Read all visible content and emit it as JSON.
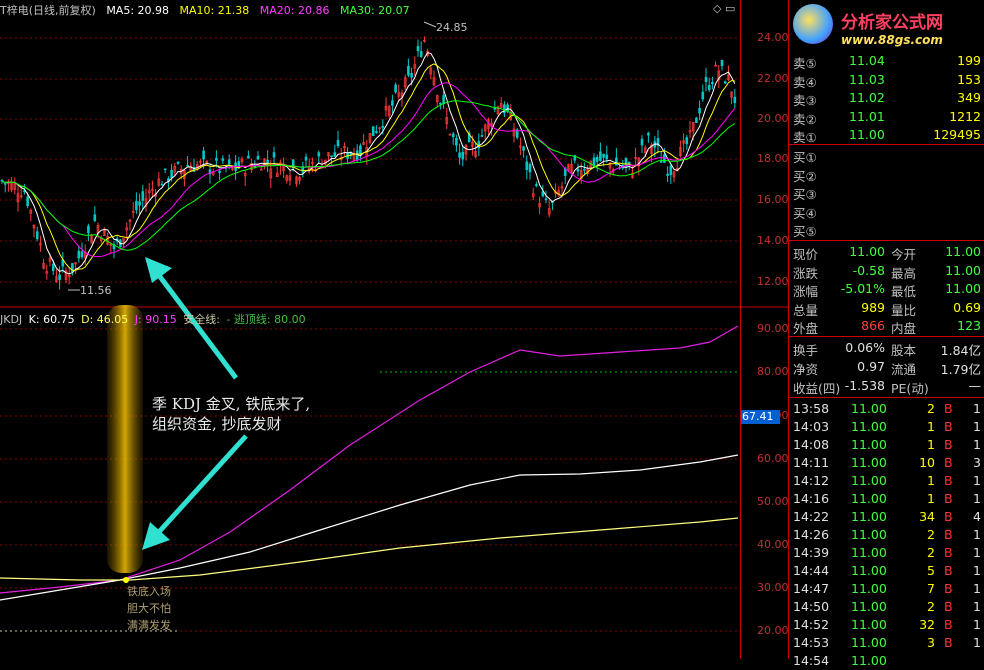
{
  "main_header": {
    "title": "T梓电(日线,前复权)",
    "ma5": "MA5: 20.98",
    "ma10": "MA10: 21.38",
    "ma20": "MA20: 20.86",
    "ma30": "MA30: 20.07"
  },
  "main_axis": [
    "24.00",
    "22.00",
    "20.00",
    "18.00",
    "16.00",
    "14.00",
    "12.00"
  ],
  "high_label": "24.85",
  "low_label": "11.56",
  "kdj_header": {
    "title": "JKDJ",
    "k": "K: 60.75",
    "d": "D: 46.05",
    "j": "J: 90.15",
    "safe": "安全线:",
    "escape": "- 逃顶线: 80.00"
  },
  "kdj_axis": [
    "90.00",
    "80.00",
    "70.00",
    "60.00",
    "50.00",
    "40.00",
    "30.00",
    "20.00"
  ],
  "kdj_marker": "67.41",
  "annotation": {
    "line1": "季 KDJ 金叉, 铁底来了,",
    "line2": "组织资金, 抄底发财"
  },
  "signal_text": {
    "line1": "铁底入场",
    "line2": "胆大不怕",
    "line3": "满满发发"
  },
  "logo": {
    "name": "分析家公式网",
    "url": "www.88gs.com"
  },
  "sell_orders": [
    {
      "label": "卖⑤",
      "price": "11.04",
      "vol": "199"
    },
    {
      "label": "卖④",
      "price": "11.03",
      "vol": "153"
    },
    {
      "label": "卖③",
      "price": "11.02",
      "vol": "349"
    },
    {
      "label": "卖②",
      "price": "11.01",
      "vol": "1212"
    },
    {
      "label": "卖①",
      "price": "11.00",
      "vol": "129495"
    }
  ],
  "buy_orders": [
    {
      "label": "买①"
    },
    {
      "label": "买②"
    },
    {
      "label": "买③"
    },
    {
      "label": "买④"
    },
    {
      "label": "买⑤"
    }
  ],
  "quote": [
    {
      "l1": "现价",
      "v1": "11.00",
      "l2": "今开",
      "v2": "11.00"
    },
    {
      "l1": "涨跌",
      "v1": "-0.58",
      "l2": "最高",
      "v2": "11.00"
    },
    {
      "l1": "涨幅",
      "v1": "-5.01%",
      "l2": "最低",
      "v2": "11.00"
    },
    {
      "l1": "总量",
      "v1": "989",
      "l2": "量比",
      "v2": "0.69"
    },
    {
      "l1": "外盘",
      "v1": "866",
      "l2": "内盘",
      "v2": "123"
    }
  ],
  "stats": [
    {
      "l1": "换手",
      "v1": "0.06%",
      "l2": "股本",
      "v2": "1.84亿"
    },
    {
      "l1": "净资",
      "v1": "0.97",
      "l2": "流通",
      "v2": "1.79亿"
    },
    {
      "l1": "收益(四)",
      "v1": "-1.538",
      "l2": "PE(动)",
      "v2": "—"
    }
  ],
  "ticks": [
    {
      "time": "13:58",
      "price": "11.00",
      "vol": "2",
      "side": "B",
      "n": "1"
    },
    {
      "time": "14:03",
      "price": "11.00",
      "vol": "1",
      "side": "B",
      "n": "1"
    },
    {
      "time": "14:08",
      "price": "11.00",
      "vol": "1",
      "side": "B",
      "n": "1"
    },
    {
      "time": "14:11",
      "price": "11.00",
      "vol": "10",
      "side": "B",
      "n": "3"
    },
    {
      "time": "14:12",
      "price": "11.00",
      "vol": "1",
      "side": "B",
      "n": "1"
    },
    {
      "time": "14:16",
      "price": "11.00",
      "vol": "1",
      "side": "B",
      "n": "1"
    },
    {
      "time": "14:22",
      "price": "11.00",
      "vol": "34",
      "side": "B",
      "n": "4"
    },
    {
      "time": "14:26",
      "price": "11.00",
      "vol": "2",
      "side": "B",
      "n": "1"
    },
    {
      "time": "14:39",
      "price": "11.00",
      "vol": "2",
      "side": "B",
      "n": "1"
    },
    {
      "time": "14:44",
      "price": "11.00",
      "vol": "5",
      "side": "B",
      "n": "1"
    },
    {
      "time": "14:47",
      "price": "11.00",
      "vol": "7",
      "side": "B",
      "n": "1"
    },
    {
      "time": "14:50",
      "price": "11.00",
      "vol": "2",
      "side": "B",
      "n": "1"
    },
    {
      "time": "14:52",
      "price": "11.00",
      "vol": "32",
      "side": "B",
      "n": "1"
    },
    {
      "time": "14:53",
      "price": "11.00",
      "vol": "3",
      "side": "B",
      "n": "1"
    },
    {
      "time": "14:54",
      "price": "11.00",
      "vol": "",
      "side": "",
      "n": ""
    }
  ],
  "colors": {
    "up": "#ff3b3b",
    "down": "#00c8c8",
    "grid": "#a00000",
    "ma5": "#ffffff",
    "ma10": "#ffff00",
    "ma20": "#ff00ff",
    "ma30": "#00ff00",
    "price": "#ffff00",
    "vol": "#ffff00",
    "neg": "#00ff00"
  }
}
